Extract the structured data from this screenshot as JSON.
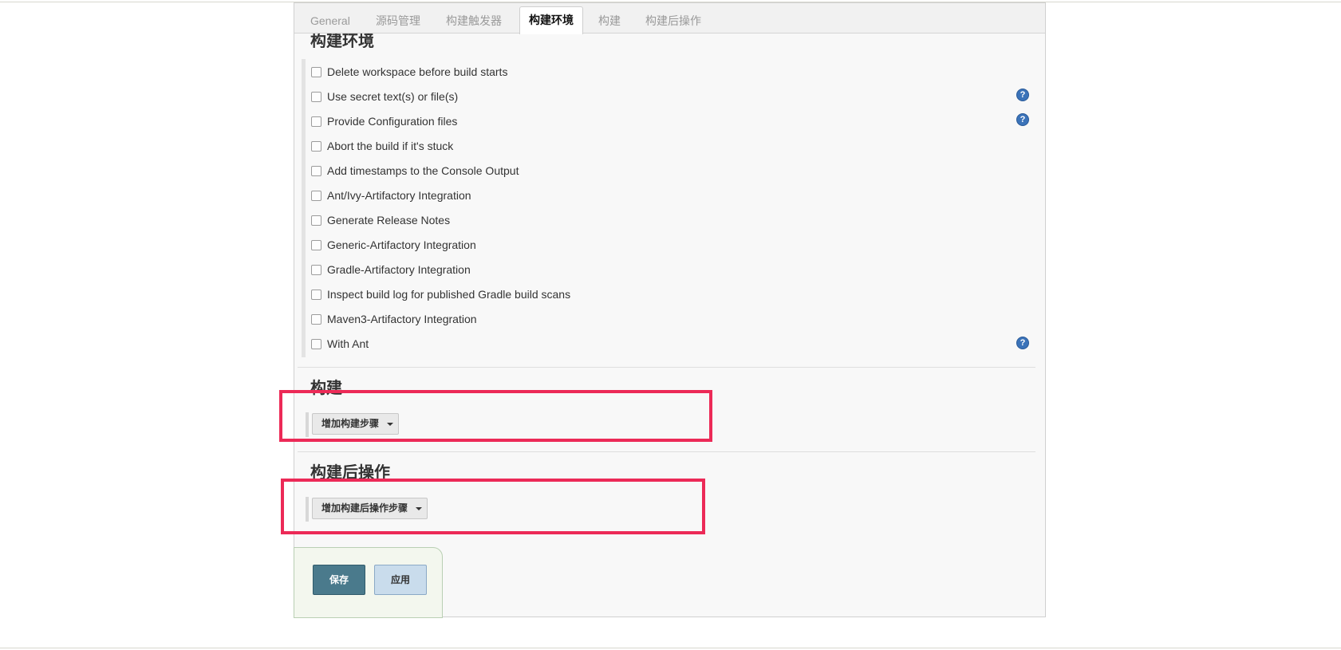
{
  "tabs": [
    {
      "label": "General"
    },
    {
      "label": "源码管理"
    },
    {
      "label": "构建触发器"
    },
    {
      "label": "构建环境",
      "active": true
    },
    {
      "label": "构建"
    },
    {
      "label": "构建后操作"
    }
  ],
  "build_env": {
    "title": "构建环境",
    "options": [
      {
        "label": "Delete workspace before build starts"
      },
      {
        "label": "Use secret text(s) or file(s)"
      },
      {
        "label": "Provide Configuration files"
      },
      {
        "label": "Abort the build if it's stuck"
      },
      {
        "label": "Add timestamps to the Console Output"
      },
      {
        "label": "Ant/Ivy-Artifactory Integration"
      },
      {
        "label": "Generate Release Notes"
      },
      {
        "label": "Generic-Artifactory Integration"
      },
      {
        "label": "Gradle-Artifactory Integration"
      },
      {
        "label": "Inspect build log for published Gradle build scans"
      },
      {
        "label": "Maven3-Artifactory Integration"
      },
      {
        "label": "With Ant"
      }
    ],
    "help_glyph": "?"
  },
  "build": {
    "title": "构建",
    "add_step_label": "增加构建步骤"
  },
  "post_build": {
    "title": "构建后操作",
    "add_step_label": "增加构建后操作步骤"
  },
  "buttons": {
    "save": "保存",
    "apply": "应用"
  },
  "colors": {
    "highlight": "#ec2a57",
    "save_bg": "#4a7a8c",
    "apply_bg": "#c9dcec",
    "help_icon": "#3b73b9"
  },
  "icons": [
    "help-icon",
    "caret-down-icon",
    "checkbox"
  ]
}
